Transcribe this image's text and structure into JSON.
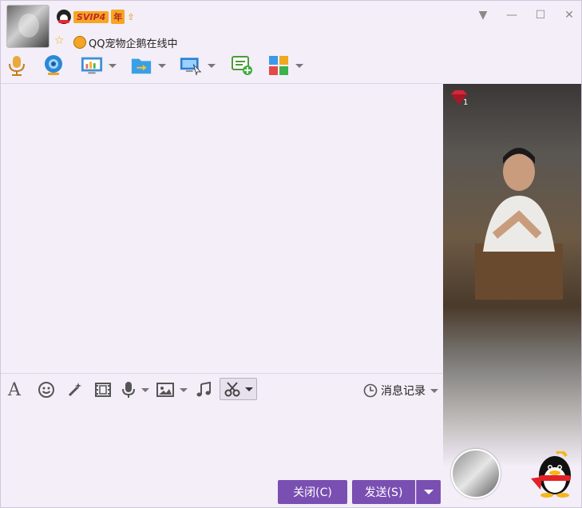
{
  "header": {
    "vip_badge": "SVIP4",
    "year_badge": "年",
    "status_text": "QQ宠物企鹅在线中",
    "window_controls": [
      "dropdown-icon",
      "minimize-icon",
      "maximize-icon",
      "close-icon"
    ]
  },
  "toolbar": {
    "items": [
      "microphone-icon",
      "video-camera-icon",
      "screen-share-icon",
      "file-transfer-icon",
      "remote-desktop-icon",
      "new-chat-icon",
      "apps-grid-icon"
    ]
  },
  "input_tools": {
    "items": [
      "font-icon",
      "emoji-icon",
      "magic-wand-icon",
      "film-icon",
      "voice-icon",
      "image-icon",
      "music-icon",
      "scissors-icon"
    ],
    "history_label": "消息记录"
  },
  "buttons": {
    "close_label": "关闭(C)",
    "send_label": "发送(S)"
  },
  "side_panel": {
    "gem_level": "1"
  },
  "colors": {
    "background": "#f3eef8",
    "button": "#7a4fb2",
    "vip_badge": "#f5a623"
  }
}
